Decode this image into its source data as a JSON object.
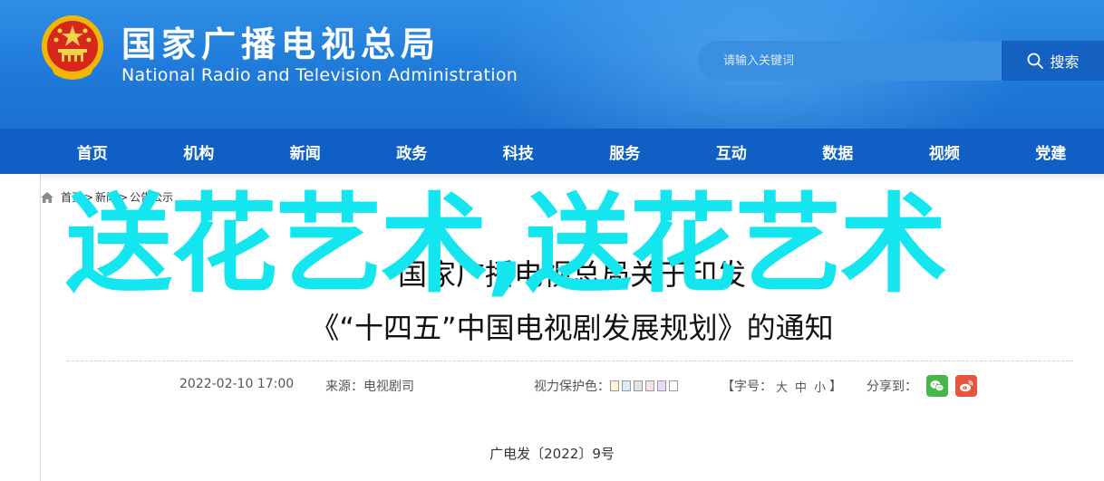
{
  "header": {
    "site_name_cn": "国家广播电视总局",
    "site_name_en": "National Radio and Television Administration",
    "search": {
      "placeholder": "请输入关键词",
      "button_label": "搜索"
    }
  },
  "nav": {
    "items": [
      "首页",
      "机构",
      "新闻",
      "政务",
      "科技",
      "服务",
      "互动",
      "数据",
      "视频",
      "党建"
    ]
  },
  "breadcrumb": {
    "items": [
      "首页",
      "新闻",
      "公告公示"
    ],
    "separator": ">"
  },
  "watermark": "送花艺术,送花艺术",
  "article": {
    "title_line1": "国家广播电视总局关于印发",
    "title_line2": "《“十四五”中国电视剧发展规划》的通知",
    "date": "2022-02-10 17:00",
    "source": "来源：电视剧司",
    "eye_care_label": "视力保护色：",
    "eye_care_colors": [
      "#fdf6cf",
      "#d6ecfa",
      "#e3e3e3",
      "#fbe0ea",
      "#ead9f7",
      "#ffffff"
    ],
    "font_size_open": "【字号：",
    "font_size_options": [
      "大",
      "中",
      "小"
    ],
    "font_size_close": "】",
    "share_label": "分享到：",
    "share_wechat_color": "#46b849",
    "share_weibo_color": "#e8553e",
    "doc_number": "广电发〔2022〕9号"
  }
}
